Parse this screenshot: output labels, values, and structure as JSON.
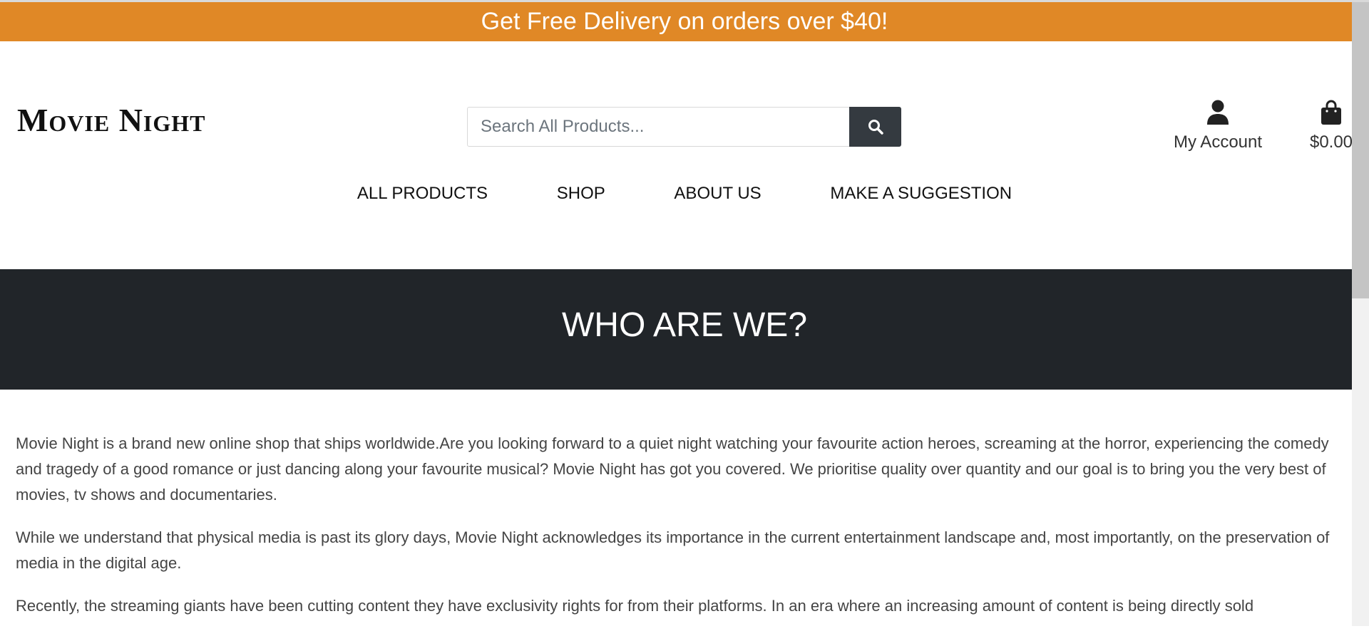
{
  "banner": {
    "text": "Get Free Delivery on orders over $40!"
  },
  "header": {
    "logo": "Movie Night",
    "search": {
      "placeholder": "Search All Products...",
      "value": ""
    },
    "account_label": "My Account",
    "cart_total": "$0.00"
  },
  "nav": {
    "items": [
      {
        "label": "ALL PRODUCTS"
      },
      {
        "label": "SHOP"
      },
      {
        "label": "ABOUT US"
      },
      {
        "label": "MAKE A SUGGESTION"
      }
    ]
  },
  "hero": {
    "title": "WHO ARE WE?"
  },
  "content": {
    "paragraphs": [
      "Movie Night is a brand new online shop that ships worldwide.Are you looking forward to a quiet night watching your favourite action heroes, screaming at the horror, experiencing the comedy and tragedy of a good romance or just dancing along your favourite musical? Movie Night has got you covered. We prioritise quality over quantity and our goal is to bring you the very best of movies, tv shows and documentaries.",
      "While we understand that physical media is past its glory days, Movie Night acknowledges its importance in the current entertainment landscape and, most importantly, on the preservation of media in the digital age.",
      "Recently, the streaming giants have been cutting content they have exclusivity rights for from their platforms. In an era where an increasing amount of content is being directly sold"
    ]
  },
  "colors": {
    "banner_bg": "#e08826",
    "hero_bg": "#212529",
    "search_button_bg": "#343a40"
  },
  "icons": {
    "search": "search-icon",
    "account": "user-icon",
    "cart": "shopping-bag-icon"
  }
}
